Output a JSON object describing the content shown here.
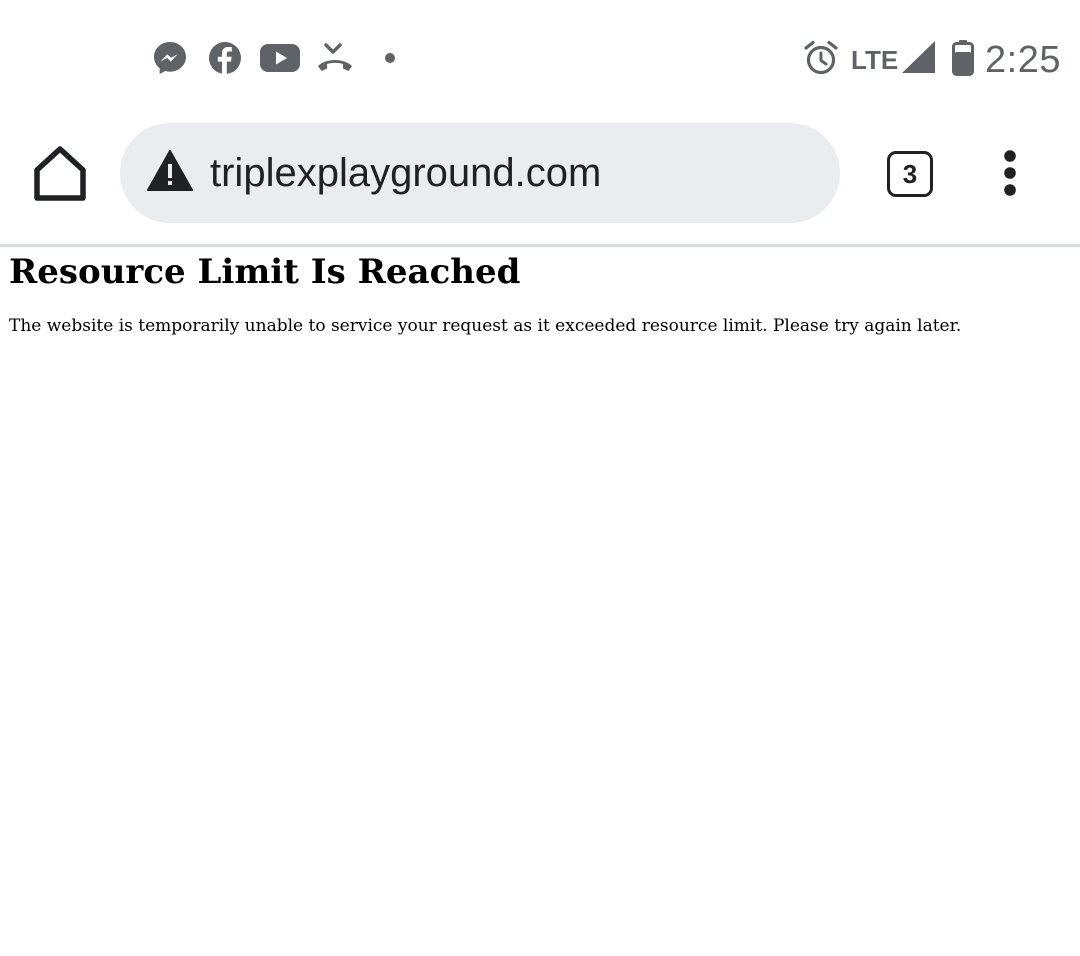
{
  "status_bar": {
    "notification_icons": [
      "messenger-icon",
      "facebook-icon",
      "youtube-icon",
      "missed-call-icon",
      "more-notifications-dot-icon"
    ],
    "system_icons": [
      "alarm-icon",
      "lte-signal-icon",
      "battery-icon"
    ],
    "network_label": "LTE",
    "time": "2:25",
    "icon_color": "#5f6368"
  },
  "toolbar": {
    "home_icon": "home-icon",
    "security_icon": "warning-triangle-icon",
    "url": "triplexplayground.com",
    "tab_count": "3",
    "menu_icon": "more-vert-icon",
    "omnibox_color": "#ebecef"
  },
  "page": {
    "heading": "Resource Limit Is Reached",
    "message": "The website is temporarily unable to service your request as it exceeded resource limit. Please try again later."
  }
}
